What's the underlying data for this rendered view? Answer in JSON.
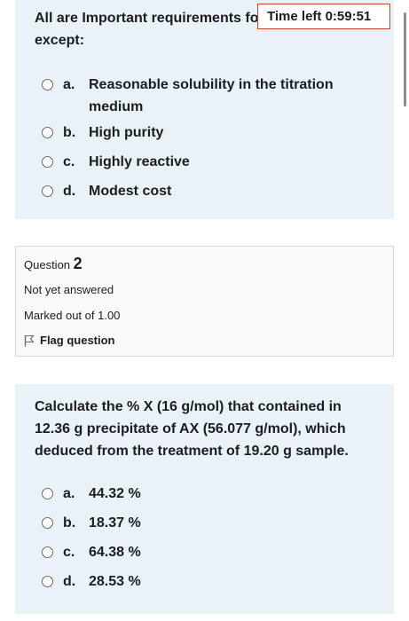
{
  "question1": {
    "text": "All are Important requirements for standard except:",
    "options": [
      {
        "letter": "a.",
        "text": "Reasonable solubility in the titration medium"
      },
      {
        "letter": "b.",
        "text": "High purity"
      },
      {
        "letter": "c.",
        "text": "Highly reactive"
      },
      {
        "letter": "d.",
        "text": "Modest cost"
      }
    ]
  },
  "timer": {
    "label": "Time left 0:59:51"
  },
  "info": {
    "question_label": "Question",
    "question_number": "2",
    "status": "Not yet answered",
    "marks": "Marked out of 1.00",
    "flag_label": "Flag question",
    "flag_icon": "flag-icon"
  },
  "question2": {
    "text": "Calculate the % X (16 g/mol) that contained in 12.36 g precipitate of AX (56.077 g/mol), which deduced from the treatment of 19.20 g sample.",
    "options": [
      {
        "letter": "a.",
        "text": "44.32 %"
      },
      {
        "letter": "b.",
        "text": "18.37 %"
      },
      {
        "letter": "c.",
        "text": "64.38 %"
      },
      {
        "letter": "d.",
        "text": "28.53 %"
      }
    ]
  }
}
